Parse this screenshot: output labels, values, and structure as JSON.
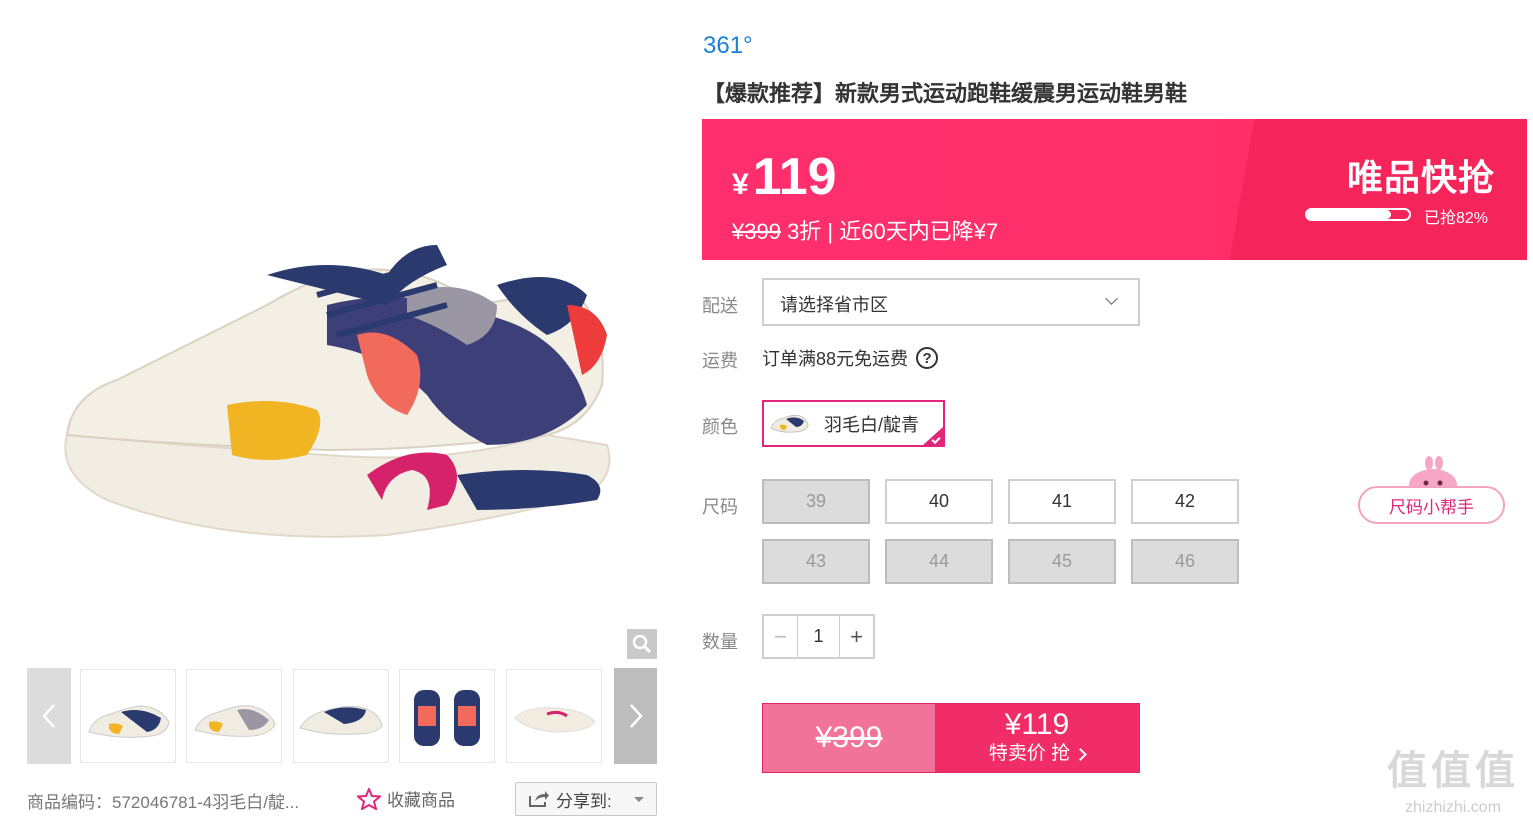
{
  "product": {
    "brand": "361°",
    "title": "【爆款推荐】新款男式运动跑鞋缓震男运动鞋男鞋"
  },
  "price": {
    "currency": "¥",
    "current": "119",
    "original": "¥399",
    "discount_text": " 3折 | 近60天内已降¥7",
    "flash_label": "唯品快抢",
    "progress_fraction": 0.82,
    "progress_label": "已抢82%"
  },
  "delivery": {
    "label": "配送",
    "placeholder": "请选择省市区"
  },
  "shipping": {
    "label": "运费",
    "text": "订单满88元免运费",
    "help_glyph": "?"
  },
  "color": {
    "label": "颜色",
    "selected": "羽毛白/靛青"
  },
  "size": {
    "label": "尺码",
    "options": [
      {
        "value": "39",
        "available": false
      },
      {
        "value": "40",
        "available": true
      },
      {
        "value": "41",
        "available": true
      },
      {
        "value": "42",
        "available": true
      },
      {
        "value": "43",
        "available": false
      },
      {
        "value": "44",
        "available": false
      },
      {
        "value": "45",
        "available": false
      },
      {
        "value": "46",
        "available": false
      }
    ],
    "helper_label": "尺码小帮手"
  },
  "quantity": {
    "label": "数量",
    "value": "1",
    "minus": "−",
    "plus": "+"
  },
  "buy": {
    "original": "¥399",
    "price": "¥119",
    "label": "特卖价 抢"
  },
  "gallery": {
    "thumbnail_count": 5
  },
  "meta": {
    "sku_code": "商品编码：572046781-4羽毛白/靛...",
    "favorite_label": "收藏商品",
    "share_label": "分享到:"
  },
  "watermark": {
    "logo": "值值值",
    "url": "zhizhizhi.com"
  },
  "colors": {
    "accent": "#f02d66",
    "brand_link": "#1a7fd9",
    "banner": "#ff2f6e"
  }
}
